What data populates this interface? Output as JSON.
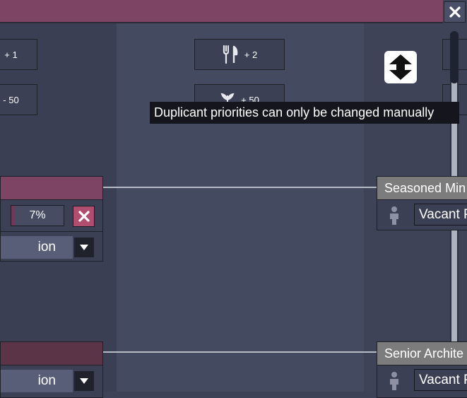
{
  "window": {
    "close_label": "×"
  },
  "perks": [
    {
      "icon": "unknown-perk-icon",
      "value": "+ 1"
    },
    {
      "icon": "fork-knife-icon",
      "value": "+ 2"
    },
    {
      "icon": "unknown-perk-icon",
      "value": "- 50"
    },
    {
      "icon": "decor-plant-icon",
      "value": "+ 50"
    }
  ],
  "tooltip": {
    "text": "Duplicant priorities can only be changed manually"
  },
  "left_panels": [
    {
      "progress": "7%",
      "progress_fraction": 0.07,
      "dropdown": "ion",
      "head_color": "#7d4563"
    },
    {
      "dropdown": "ion",
      "head_color": "#5c3447"
    }
  ],
  "right_panels": [
    {
      "title": "Seasoned Min",
      "assignee": "Vacant P"
    },
    {
      "title": "Senior Archite",
      "assignee": "Vacant P"
    }
  ]
}
